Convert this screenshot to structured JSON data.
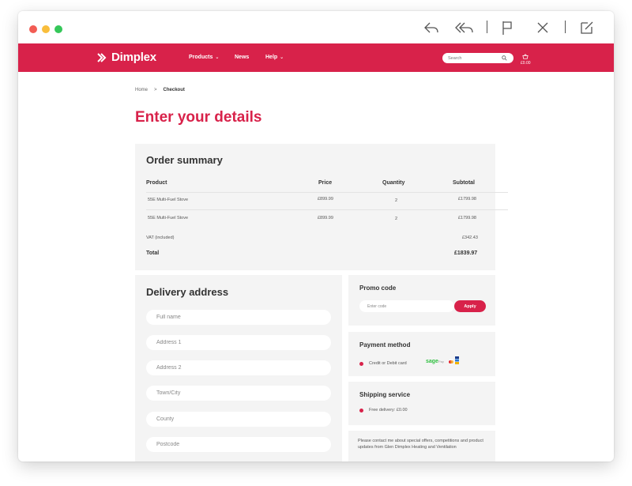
{
  "brand": {
    "name": "Dimplex",
    "accent": "#d8224a"
  },
  "nav": {
    "items": [
      {
        "label": "Products",
        "chevron": "chevron-down-icon"
      },
      {
        "label": "News"
      },
      {
        "label": "Help",
        "chevron": "chevron-down-icon"
      }
    ],
    "search_placeholder": "Search",
    "cart_total": "£0.00"
  },
  "breadcrumb": {
    "home": "Home",
    "separator": ">",
    "current": "Checkout"
  },
  "page_title": "Enter your details",
  "order_summary": {
    "title": "Order summary",
    "columns": [
      "Product",
      "Price",
      "Quantity",
      "Subtotal"
    ],
    "rows": [
      {
        "product": "55E Multi-Fuel Stove",
        "price": "£899.99",
        "quantity": "2",
        "subtotal": "£1799.98"
      },
      {
        "product": "55E Multi-Fuel Stove",
        "price": "£899.99",
        "quantity": "2",
        "subtotal": "£1799.98"
      }
    ],
    "vat_label": "VAT (included)",
    "vat_value": "£342.43",
    "total_label": "Total",
    "total_value": "£1839.97"
  },
  "delivery": {
    "title": "Delivery address",
    "fields": [
      "Full name",
      "Address 1",
      "Address 2",
      "Town/City",
      "County",
      "Postcode"
    ]
  },
  "promo": {
    "title": "Promo code",
    "placeholder": "Enter code",
    "apply_label": "Apply"
  },
  "payment": {
    "title": "Payment method",
    "option": "Credit or Debit card",
    "provider": "sage",
    "provider_suffix": "Pay"
  },
  "shipping": {
    "title": "Shipping service",
    "option": "Free delivery: £0.00"
  },
  "consent": {
    "text": "Please contact me about special offers, competitions and product updates from Glen Dimplex Heating and Ventilation"
  },
  "toolbar_icons": [
    "reply-icon",
    "reply-all-icon",
    "flag-icon",
    "close-icon",
    "compose-icon"
  ]
}
